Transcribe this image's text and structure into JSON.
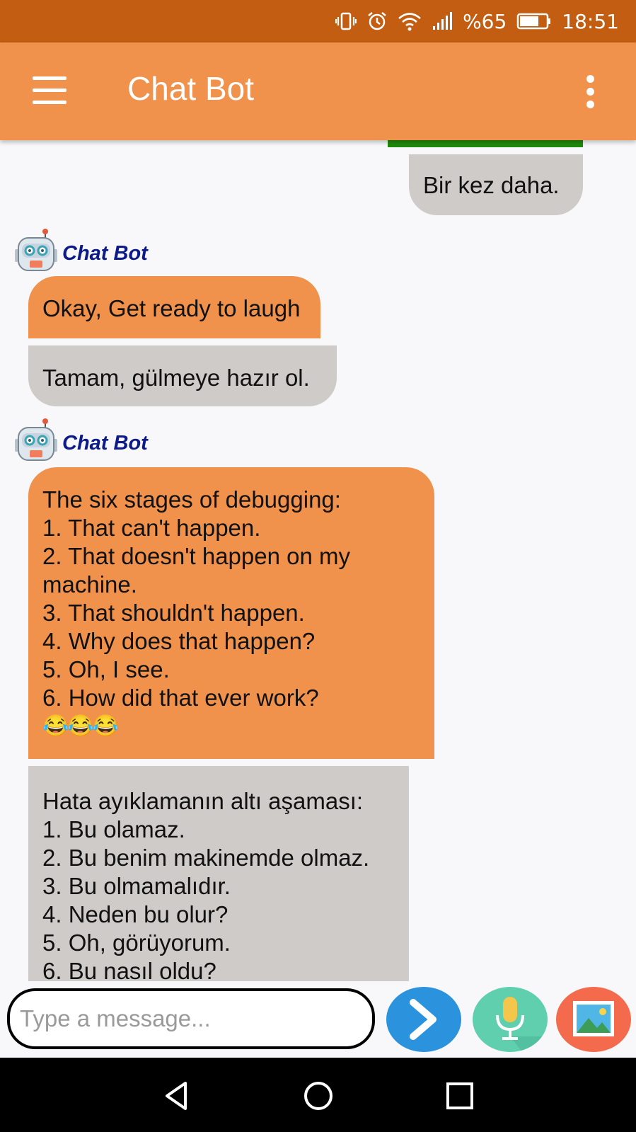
{
  "status_bar": {
    "battery_percent": "%65",
    "time": "18:51",
    "icons": [
      "vibrate-icon",
      "alarm-icon",
      "wifi-icon",
      "signal-icon",
      "battery-icon"
    ]
  },
  "app_bar": {
    "title": "Chat Bot",
    "menu_icon": "hamburger-menu-icon",
    "overflow_icon": "more-vertical-icon"
  },
  "chat": {
    "user_message": "Bir kez daha.",
    "bot_name": "Chat Bot",
    "messages": [
      {
        "english": [
          "Okay, Get ready to laugh"
        ],
        "turkish": [
          "Tamam, gülmeye hazır ol."
        ]
      },
      {
        "english": [
          "The six stages of debugging:",
          "1. That can't happen.",
          "2. That doesn't happen on my",
          "machine.",
          "3. That shouldn't happen.",
          "4. Why does that happen?",
          "5. Oh, I see.",
          "6. How did that ever work?",
          "😂😂😂"
        ],
        "turkish": [
          "Hata ayıklamanın altı aşaması:",
          "1. Bu olamaz.",
          "2. Bu benim makinemde olmaz.",
          "3. Bu olmamalıdır.",
          "4. Neden bu olur?",
          "5. Oh, görüyorum.",
          "6. Bu nasıl oldu?"
        ]
      }
    ]
  },
  "composer": {
    "placeholder": "Type a message...",
    "value": "",
    "send_icon": "send-arrow-icon",
    "mic_icon": "microphone-icon",
    "image_icon": "image-gallery-icon"
  },
  "nav_bar": {
    "icons": [
      "back-triangle-icon",
      "home-circle-icon",
      "recents-square-icon"
    ]
  },
  "colors": {
    "status_bar": "#c25d12",
    "app_bar": "#f0924c",
    "bot_bubble_english": "#f0924c",
    "bubble_grey": "#cfcbc9",
    "bot_name": "#0c1a8a",
    "send_button": "#2b92de",
    "mic_button": "#5fcfae",
    "image_button": "#f36b4c"
  }
}
